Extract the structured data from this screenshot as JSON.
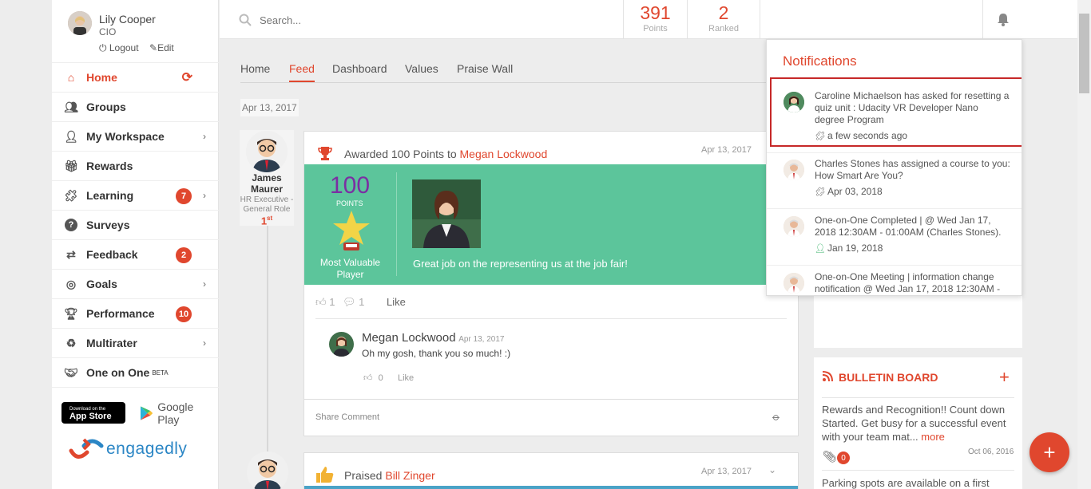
{
  "user": {
    "name": "Lily Cooper",
    "role": "CIO",
    "logout": "Logout",
    "edit": "Edit"
  },
  "nav": [
    {
      "label": "Home",
      "icon": "home-icon",
      "active": true
    },
    {
      "label": "Groups",
      "icon": "users-icon"
    },
    {
      "label": "My Workspace",
      "icon": "person-icon",
      "chevron": true
    },
    {
      "label": "Rewards",
      "icon": "gift-icon"
    },
    {
      "label": "Learning",
      "icon": "puzzle-icon",
      "badge": "7",
      "chevron": true
    },
    {
      "label": "Surveys",
      "icon": "question-icon"
    },
    {
      "label": "Feedback",
      "icon": "exchange-icon",
      "badge": "2"
    },
    {
      "label": "Goals",
      "icon": "target-icon",
      "chevron": true
    },
    {
      "label": "Performance",
      "icon": "trophy-icon",
      "badge": "10"
    },
    {
      "label": "Multirater",
      "icon": "recycle-icon",
      "chevron": true
    },
    {
      "label": "One on One",
      "icon": "handshake-icon",
      "sup": "BETA"
    }
  ],
  "stores": {
    "appstore_small": "Download on the",
    "appstore": "App Store",
    "googleplay": "Google Play"
  },
  "brand": "engagedly",
  "search": {
    "placeholder": "Search..."
  },
  "stats": {
    "points_value": "391",
    "points_label": "Points",
    "ranked_value": "2",
    "ranked_label": "Ranked"
  },
  "tabs": [
    "Home",
    "Feed",
    "Dashboard",
    "Values",
    "Praise Wall"
  ],
  "date_chip": "Apr 13, 2017",
  "post1": {
    "author_first": "James",
    "author_last": "Maurer",
    "author_role": "HR Executive - General Role",
    "rank": "1",
    "rank_suffix": "st",
    "header_prefix": "Awarded 100 Points to",
    "recipient": "Megan Lockwood",
    "date": "Apr 13, 2017",
    "points": "100",
    "points_label": "POINTS",
    "award": "Most Valuable Player",
    "message": "Great job on the representing us at the job fair!",
    "likes": "1",
    "comments": "1",
    "like_label": "Like",
    "comment": {
      "author": "Megan Lockwood",
      "date": "Apr 13, 2017",
      "text": "Oh my gosh, thank you so much! :)",
      "likes": "0",
      "like_label": "Like"
    },
    "share_placeholder": "Share Comment"
  },
  "post2": {
    "header_prefix": "Praised",
    "recipient": "Bill Zinger",
    "date": "Apr 13, 2017"
  },
  "notifications": {
    "title": "Notifications",
    "items": [
      {
        "text": "Caroline Michaelson has asked for resetting a quiz unit : Udacity VR Developer Nano degree Program",
        "time": "a few seconds ago",
        "icon": "puzzle-icon"
      },
      {
        "text": "Charles Stones has assigned a course to you: How Smart Are You?",
        "time": "Apr 03, 2018",
        "icon": "puzzle-icon"
      },
      {
        "text": "One-on-One Completed | @ Wed Jan 17, 2018 12:30AM - 01:00AM (Charles Stones).",
        "time": "Jan 19, 2018",
        "icon": "person-icon"
      },
      {
        "text": "One-on-One Meeting | information change notification @ Wed Jan 17, 2018 12:30AM -",
        "time": "",
        "icon": ""
      }
    ]
  },
  "bulletin": {
    "title": "BULLETIN BOARD",
    "item1_text": "Rewards and Recognition!! Count down Started. Get busy for a successful event with your team mat...",
    "more": "more",
    "attachments": "0",
    "item1_date": "Oct 06, 2016",
    "item2_text": "Parking spots are available on a first"
  },
  "colors": {
    "accent": "#e0472e",
    "green": "#5cc59b",
    "purple": "#7b2fa3",
    "blue_bar": "#4aa3c7"
  }
}
